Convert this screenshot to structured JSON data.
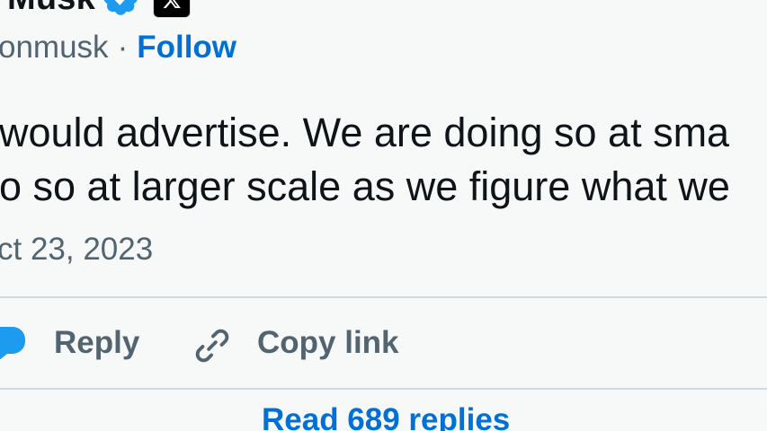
{
  "author": {
    "name": "Musk",
    "handle": "onmusk",
    "separator": "·",
    "follow_label": "Follow"
  },
  "tweet": {
    "lines": [
      "would advertise. We are doing so at sma",
      "o so at larger scale as we figure what we"
    ],
    "date": "ct 23, 2023"
  },
  "actions": {
    "reply_label": "Reply",
    "copy_link_label": "Copy link"
  },
  "footer": {
    "read_replies_label": "Read 689 replies"
  },
  "icons": {
    "verified": "verified-badge-icon",
    "x_logo": "x-logo-icon",
    "reply": "speech-bubble-icon",
    "link": "link-icon"
  },
  "colors": {
    "background": "#f7f9f9",
    "text_primary": "#0f1419",
    "text_secondary": "#536471",
    "accent_blue": "#006fd6",
    "verified_blue": "#1d9bf0",
    "divider": "#cfd9de"
  }
}
